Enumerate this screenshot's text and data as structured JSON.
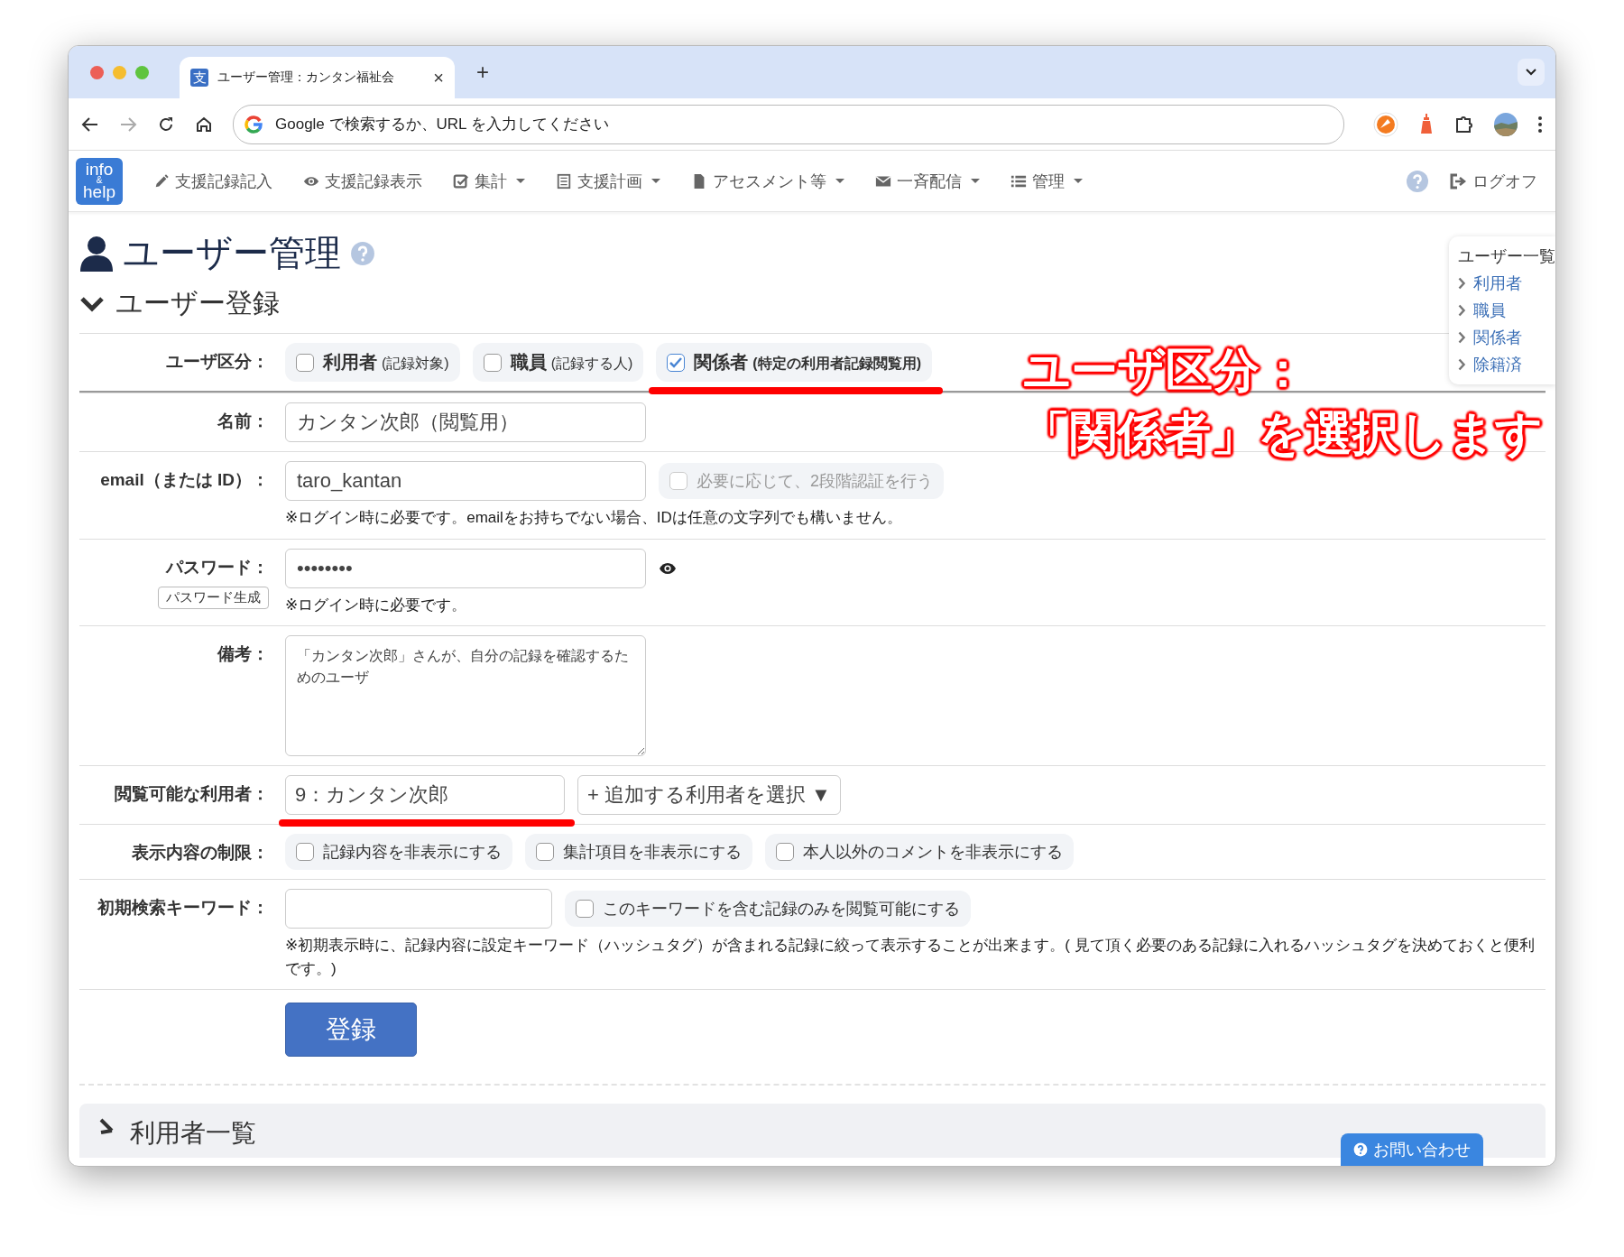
{
  "browser": {
    "tab": {
      "favicon": "支",
      "title": "ユーザー管理：カンタン福祉会",
      "close": "×"
    },
    "new_tab": "+",
    "address": {
      "placeholder": "Google で検索するか、URL を入力してください"
    }
  },
  "navbar": {
    "logo": [
      "info",
      "&",
      "help"
    ],
    "items": [
      {
        "label": "支援記録記入",
        "dropdown": false
      },
      {
        "label": "支援記録表示",
        "dropdown": false
      },
      {
        "label": "集計",
        "dropdown": true
      },
      {
        "label": "支援計画",
        "dropdown": true
      },
      {
        "label": "アセスメント等",
        "dropdown": true
      },
      {
        "label": "一斉配信",
        "dropdown": true
      },
      {
        "label": "管理",
        "dropdown": true
      }
    ],
    "logoff": "ログオフ"
  },
  "page_title": "ユーザー管理",
  "section_title": "ユーザー登録",
  "form": {
    "rows": [
      {
        "kind": "choices",
        "label": "ユーザ区分：",
        "options": [
          {
            "label": "利用者",
            "note": "(記録対象)",
            "checked": false,
            "underlined": false
          },
          {
            "label": "職員",
            "note": "(記録する人)",
            "checked": false,
            "underlined": false
          },
          {
            "label": "関係者",
            "note": "(特定の利用者記録閲覧用)",
            "checked": true,
            "underlined": true
          }
        ]
      },
      {
        "kind": "text",
        "label": "名前：",
        "value": "カンタン次郎（閲覧用）"
      },
      {
        "kind": "text",
        "label": "email（または ID）：",
        "value": "taro_kantan",
        "option": {
          "label": "必要に応じて、2段階認証を行う",
          "checked": false,
          "disabled": true
        },
        "note": "※ログイン時に必要です。emailをお持ちでない場合、IDは任意の文字列でも構いません。"
      },
      {
        "kind": "password",
        "label": "パスワード：",
        "button": "パスワード生成",
        "value": "••••••••",
        "note": "※ログイン時に必要です。"
      },
      {
        "kind": "textarea",
        "label": "備考：",
        "value": "「カンタン次郎」さんが、自分の記録を確認するためのユーザ"
      },
      {
        "kind": "select",
        "label": "閲覧可能な利用者：",
        "value": "9：カンタン次郎",
        "underlined": true,
        "add": "+ 追加する利用者を選択 ▼"
      },
      {
        "kind": "checks",
        "label": "表示内容の制限：",
        "options": [
          {
            "label": "記録内容を非表示にする",
            "checked": false
          },
          {
            "label": "集計項目を非表示にする",
            "checked": false
          },
          {
            "label": "本人以外のコメントを非表示にする",
            "checked": false
          }
        ]
      },
      {
        "kind": "keyword",
        "label": "初期検索キーワード：",
        "option": {
          "label": "このキーワードを含む記録のみを閲覧可能にする",
          "checked": false,
          "disabled": false
        },
        "note": "※初期表示時に、記録内容に設定キーワード（ハッシュタグ）が含まれる記録に絞って表示することが出来ます。( 見て頂く必要のある記録に入れるハッシュタグを決めておくと便利です。)"
      }
    ],
    "submit": "登録"
  },
  "sidebar": {
    "title": "ユーザー一覧",
    "links": [
      "利用者",
      "職員",
      "関係者",
      "除籍済"
    ]
  },
  "annotation": [
    "ユーザ区分：",
    "「関係者」を選択します"
  ],
  "bottom_section": {
    "title": "利用者一覧"
  },
  "contact_button": "お問い合わせ"
}
